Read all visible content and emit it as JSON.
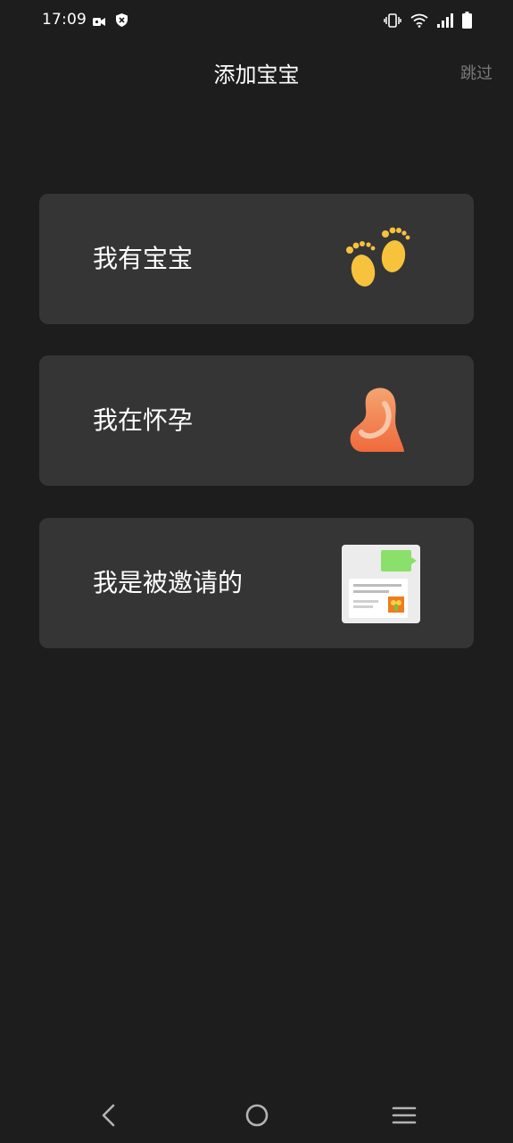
{
  "status_bar": {
    "time": "17:09",
    "left_icons": [
      "video-camera-icon",
      "shield-icon"
    ],
    "right_icons": [
      "vibrate-icon",
      "wifi-icon",
      "signal-icon",
      "battery-icon"
    ]
  },
  "header": {
    "title": "添加宝宝",
    "skip_label": "跳过"
  },
  "options": [
    {
      "label": "我有宝宝",
      "icon": "baby-footprints-icon"
    },
    {
      "label": "我在怀孕",
      "icon": "pregnant-belly-icon"
    },
    {
      "label": "我是被邀请的",
      "icon": "invitation-card-icon"
    }
  ],
  "nav_bar": {
    "buttons": [
      "back-icon",
      "home-icon",
      "menu-icon"
    ]
  },
  "colors": {
    "background": "#1d1d1d",
    "card": "#353535",
    "skip_text": "#7a7a7a",
    "footprint": "#f7c23c",
    "belly": "#f5834f",
    "invite_green": "#8be06b"
  }
}
